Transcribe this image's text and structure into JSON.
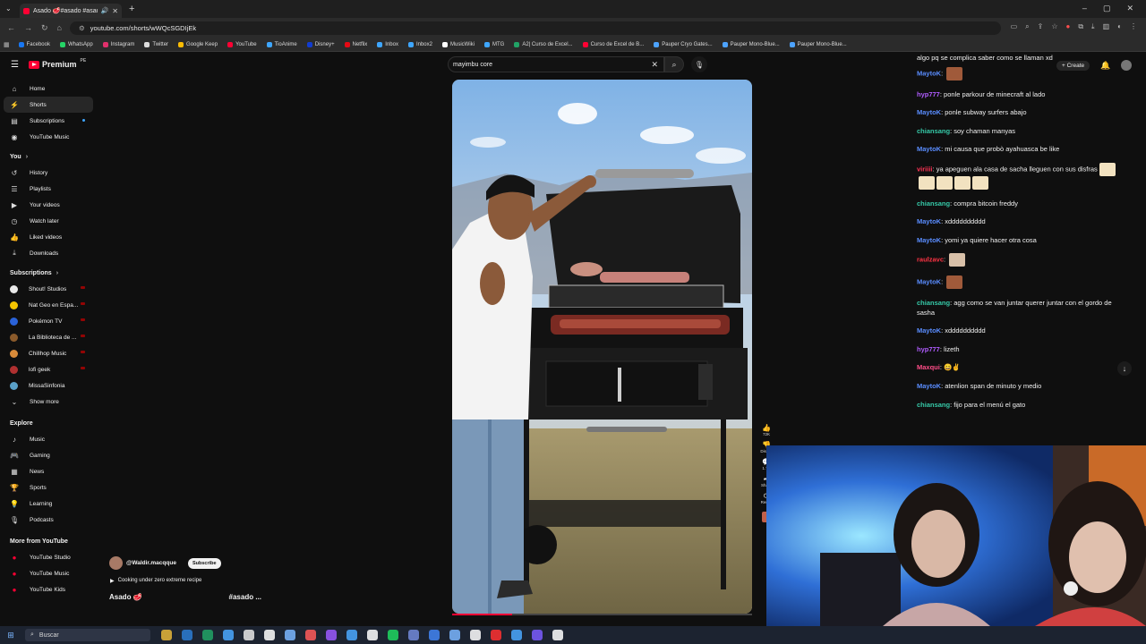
{
  "browser": {
    "tab_title": "Asado 🥩#asado #asado...",
    "url": "youtube.com/shorts/wWQcSGDIjEk",
    "bookmarks": [
      {
        "label": "Facebook",
        "color": "#1877f2"
      },
      {
        "label": "WhatsApp",
        "color": "#25d366"
      },
      {
        "label": "Instagram",
        "color": "#e1306c"
      },
      {
        "label": "Twitter",
        "color": "#dddddd"
      },
      {
        "label": "Google Keep",
        "color": "#fbbc04"
      },
      {
        "label": "YouTube",
        "color": "#ff0033"
      },
      {
        "label": "TioAnime",
        "color": "#3ea6ff"
      },
      {
        "label": "Disney+",
        "color": "#113ccf"
      },
      {
        "label": "Netflix",
        "color": "#e50914"
      },
      {
        "label": "Inbox",
        "color": "#3ea6ff"
      },
      {
        "label": "Inbox2",
        "color": "#3ea6ff"
      },
      {
        "label": "MusicWiki",
        "color": "#ffffff"
      },
      {
        "label": "MTG",
        "color": "#3ea6ff"
      },
      {
        "label": "A2| Curso de Excel...",
        "color": "#21a366"
      },
      {
        "label": "Curso de Excel de B...",
        "color": "#ff0033"
      },
      {
        "label": "Pauper Cryo Gates...",
        "color": "#4da3ff"
      },
      {
        "label": "Pauper Mono-Blue...",
        "color": "#4da3ff"
      },
      {
        "label": "Pauper Mono-Blue...",
        "color": "#4da3ff"
      }
    ]
  },
  "header": {
    "logo_text": "Premium",
    "logo_suffix": "PE",
    "search_value": "mayimbu core",
    "create_label": "Create"
  },
  "sidebar": {
    "main": [
      {
        "label": "Home",
        "icon": "home-icon",
        "glyph": "⌂"
      },
      {
        "label": "Shorts",
        "icon": "shorts-icon",
        "glyph": "⚡"
      },
      {
        "label": "Subscriptions",
        "icon": "subscriptions-icon",
        "glyph": "▤"
      },
      {
        "label": "YouTube Music",
        "icon": "music-icon",
        "glyph": "◉"
      }
    ],
    "you_heading": "You",
    "you": [
      {
        "label": "History",
        "icon": "history-icon",
        "glyph": "↺"
      },
      {
        "label": "Playlists",
        "icon": "playlists-icon",
        "glyph": "☰"
      },
      {
        "label": "Your videos",
        "icon": "your-videos-icon",
        "glyph": "▶"
      },
      {
        "label": "Watch later",
        "icon": "watch-later-icon",
        "glyph": "◷"
      },
      {
        "label": "Liked videos",
        "icon": "liked-icon",
        "glyph": "👍"
      },
      {
        "label": "Downloads",
        "icon": "downloads-icon",
        "glyph": "⤓"
      }
    ],
    "subs_heading": "Subscriptions",
    "subs": [
      {
        "label": "Shout! Studios",
        "color": "#e8e8e8"
      },
      {
        "label": "Nat Geo en Espa...",
        "color": "#f5c400"
      },
      {
        "label": "Pokémon TV",
        "color": "#2a62d8"
      },
      {
        "label": "La Biblioteca de ...",
        "color": "#8a5a2b"
      },
      {
        "label": "Chillhop Music",
        "color": "#d98b3a"
      },
      {
        "label": "lofi geek",
        "color": "#b03030"
      },
      {
        "label": "MissaSinfonia",
        "color": "#5aa0c8"
      }
    ],
    "show_more": "Show more",
    "explore_heading": "Explore",
    "explore": [
      {
        "label": "Music",
        "icon": "music-note-icon",
        "glyph": "♪"
      },
      {
        "label": "Gaming",
        "icon": "gaming-icon",
        "glyph": "🎮"
      },
      {
        "label": "News",
        "icon": "news-icon",
        "glyph": "▦"
      },
      {
        "label": "Sports",
        "icon": "sports-icon",
        "glyph": "🏆"
      },
      {
        "label": "Learning",
        "icon": "learning-icon",
        "glyph": "💡"
      },
      {
        "label": "Podcasts",
        "icon": "podcasts-icon",
        "glyph": "🎙"
      }
    ],
    "more_heading": "More from YouTube",
    "more": [
      {
        "label": "YouTube Studio"
      },
      {
        "label": "YouTube Music"
      },
      {
        "label": "YouTube Kids"
      }
    ]
  },
  "short": {
    "channel": "@Waldir.macqque",
    "subscribe_label": "Subscribe",
    "recipe": "Cooking under zero extreme recipe",
    "title": "Asado 🥩",
    "hashtag": "#asado ...",
    "progress": 0.2,
    "actions": [
      {
        "icon": "like-icon",
        "glyph": "👍",
        "label": "72K"
      },
      {
        "icon": "dislike-icon",
        "glyph": "👎",
        "label": "Dislike"
      },
      {
        "icon": "comments-icon",
        "glyph": "💬",
        "label": "1.7K"
      },
      {
        "icon": "share-icon",
        "glyph": "➦",
        "label": "Share"
      },
      {
        "icon": "remix-icon",
        "glyph": "⟳",
        "label": "Remix"
      }
    ]
  },
  "chat": {
    "top_line": "algo pq se complica saber como se llaman xd",
    "messages": [
      {
        "user": "MaytoK",
        "color": "#5a8dff",
        "text": "",
        "emotes": [
          "#a05a3a"
        ]
      },
      {
        "user": "hyp777",
        "color": "#b05cff",
        "text": "ponle parkour de minecraft al lado"
      },
      {
        "user": "MaytoK",
        "color": "#5a8dff",
        "text": "ponle subway surfers abajo"
      },
      {
        "user": "chiansang",
        "color": "#36c9a8",
        "text": "soy chaman manyas"
      },
      {
        "user": "MaytoK",
        "color": "#5a8dff",
        "text": "mi causa que probò ayahuasca be like"
      },
      {
        "user": "viriiii",
        "color": "#ff3355",
        "text": "ya apeguen ala casa de sacha lleguen con sus disfras",
        "emotes": [
          "#f2e2c0",
          "#f2e2c0",
          "#f2e2c0",
          "#f2e2c0",
          "#f2e2c0"
        ]
      },
      {
        "user": "chiansang",
        "color": "#36c9a8",
        "text": "compra bitcoin freddy"
      },
      {
        "user": "MaytoK",
        "color": "#5a8dff",
        "text": "xdddddddddd"
      },
      {
        "user": "MaytoK",
        "color": "#5a8dff",
        "text": "yomi ya quiere hacer otra cosa"
      },
      {
        "user": "raulzavc",
        "color": "#ff3344",
        "text": "",
        "emotes": [
          "#d8c0a8"
        ]
      },
      {
        "user": "MaytoK",
        "color": "#5a8dff",
        "text": "",
        "emotes": [
          "#a05a3a"
        ]
      },
      {
        "user": "chiansang",
        "color": "#36c9a8",
        "text": "agg como se van juntar querer juntar con el gordo de sasha"
      },
      {
        "user": "MaytoK",
        "color": "#5a8dff",
        "text": "xdddddddddd"
      },
      {
        "user": "hyp777",
        "color": "#b05cff",
        "text": "lizeth"
      },
      {
        "user": "Maxqui",
        "color": "#ff4d88",
        "text": "😄✌"
      },
      {
        "user": "MaytoK",
        "color": "#5a8dff",
        "text": "atenlion span de minuto y medio"
      },
      {
        "user": "chiansang",
        "color": "#36c9a8",
        "text": "fijo para el menú el gato"
      }
    ]
  },
  "taskbar": {
    "search_placeholder": "Buscar",
    "apps": [
      "#e8b73a",
      "#2b7cd3",
      "#21a366",
      "#4aa8ff",
      "#e8e8e8",
      "#ffffff",
      "#7ab6ff",
      "#ff5a5a",
      "#9b59ff",
      "#4aa8ff",
      "#ffffff",
      "#1ed760",
      "#7289da",
      "#4285f4",
      "#7ab6ff",
      "#ffffff",
      "#ff3030",
      "#4aa8ff",
      "#7a5cff",
      "#ffffff"
    ]
  }
}
